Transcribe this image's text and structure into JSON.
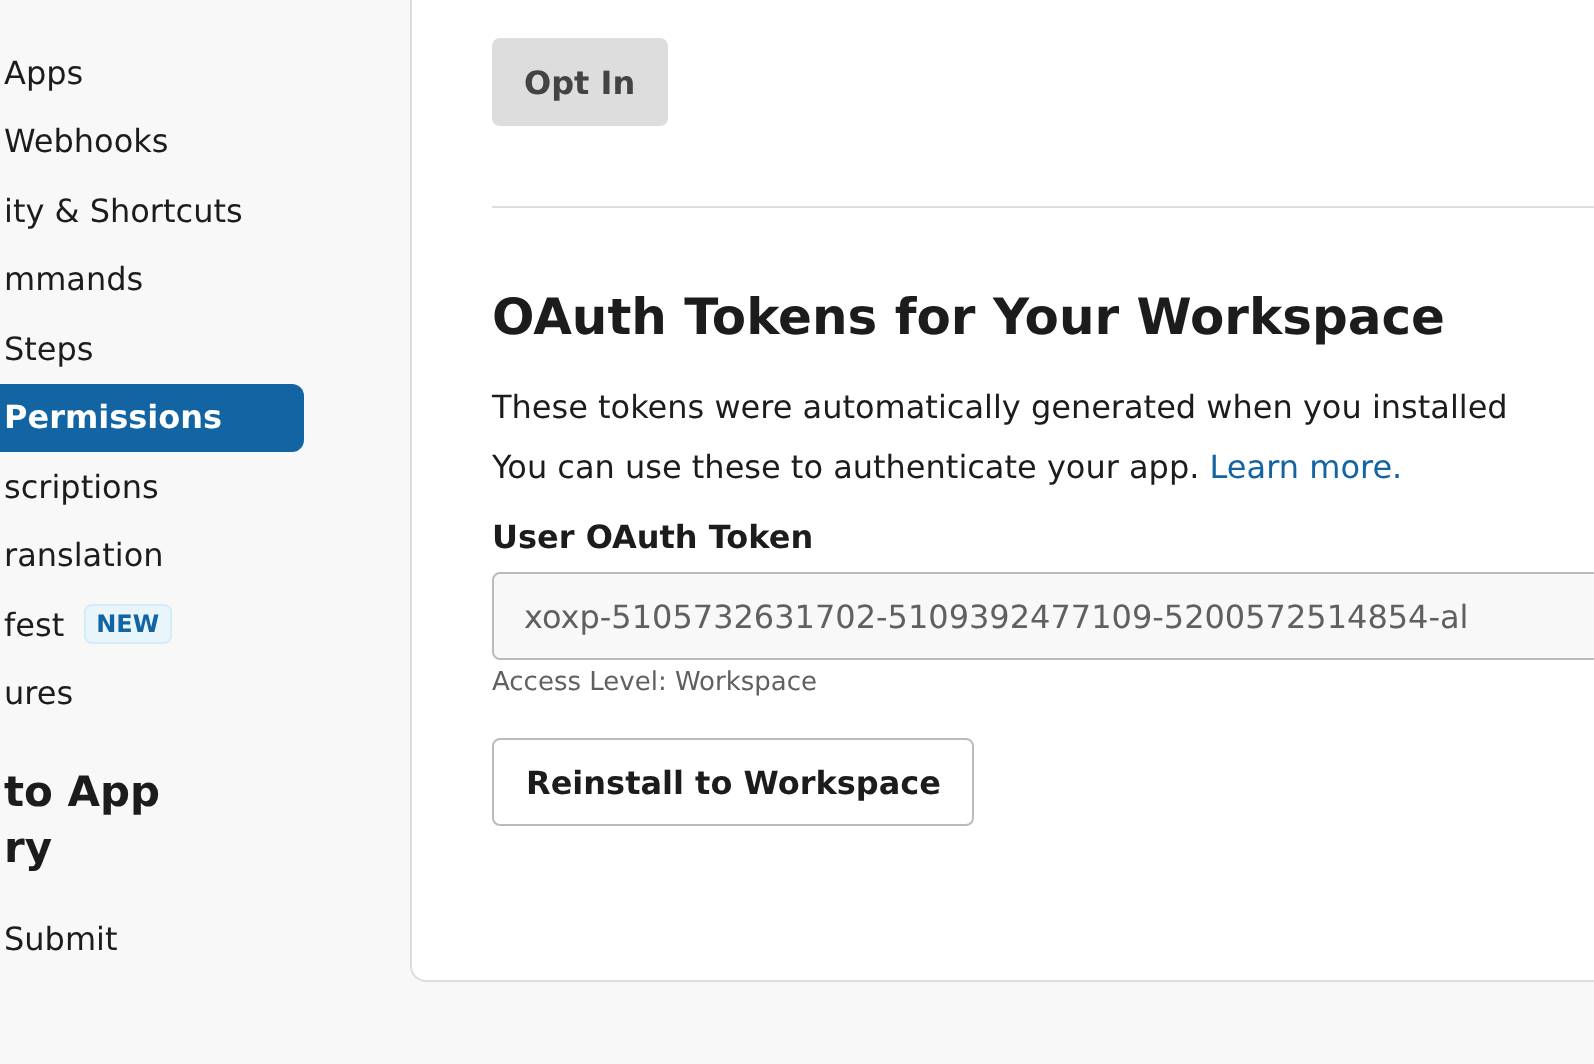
{
  "sidebar": {
    "items": [
      {
        "label": "Apps",
        "selected": false
      },
      {
        "label": "Webhooks",
        "selected": false
      },
      {
        "label": "ity & Shortcuts",
        "selected": false
      },
      {
        "label": "mmands",
        "selected": false
      },
      {
        "label": "Steps",
        "selected": false
      },
      {
        "label": "Permissions",
        "selected": true
      },
      {
        "label": "scriptions",
        "selected": false
      },
      {
        "label": "ranslation",
        "selected": false
      },
      {
        "label": "fest",
        "selected": false,
        "badge": "NEW"
      },
      {
        "label": "ures",
        "selected": false
      }
    ],
    "section_title": "to App\nry",
    "section_items": [
      {
        "label": "Submit",
        "selected": false
      }
    ]
  },
  "main": {
    "opt_in_button": "Opt In",
    "heading": "OAuth Tokens for Your Workspace",
    "description": "These tokens were automatically generated when you installed\nYou can use these to authenticate your app. ",
    "description_link": "Learn more.",
    "token_label": "User OAuth Token",
    "token_value": "xoxp-5105732631702-5109392477109-5200572514854-al",
    "access_level": "Access Level: Workspace",
    "reinstall_button": "Reinstall to Workspace"
  }
}
